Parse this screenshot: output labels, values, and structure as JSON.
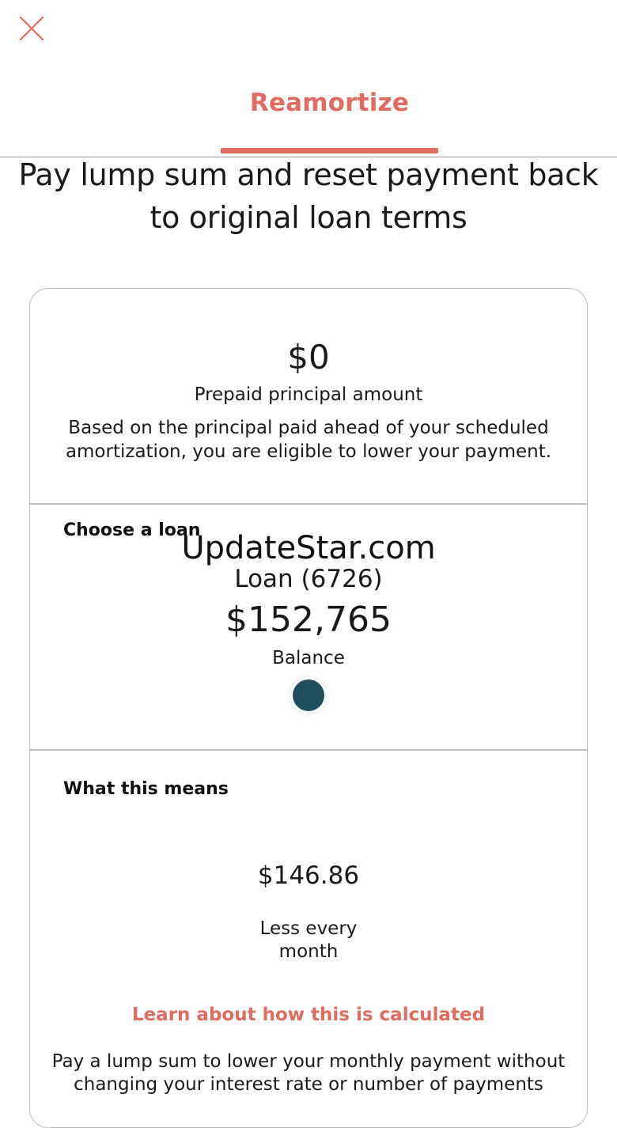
{
  "header": {
    "close_icon": "close-icon",
    "tab_label": "Reamortize"
  },
  "headline": "Pay lump sum and reset payment back to original loan terms",
  "prepaid": {
    "amount": "$0",
    "label": "Prepaid principal amount",
    "description": "Based on the principal paid ahead of your scheduled amortization, you are eligible to lower your payment."
  },
  "choose_loan": {
    "title": "Choose a loan",
    "loan_name": "Loan (6726)",
    "balance": "$152,765",
    "balance_label": "Balance",
    "selected_indicator_color": "#1f4f5b"
  },
  "what_this_means": {
    "title": "What this means",
    "amount": "$146.86",
    "amount_label": "Less every month",
    "learn_link": "Learn about how this is calculated",
    "description": "Pay a lump sum to lower your monthly payment without changing your interest rate or number of payments"
  },
  "watermark": "UpdateStar.com",
  "colors": {
    "accent": "#e06b60",
    "dot": "#1f4f5b"
  }
}
